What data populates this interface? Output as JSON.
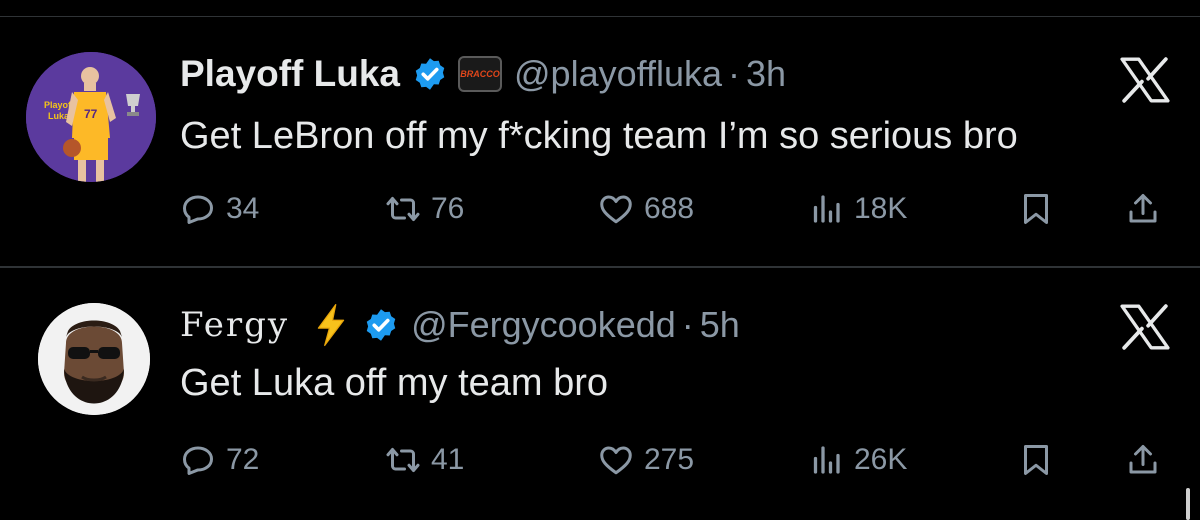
{
  "tweets": [
    {
      "name": "Playoff Luka",
      "badge_text": "BRACCO",
      "handle": "@playoffluka",
      "separator": "·",
      "time": "3h",
      "text": "Get LeBron off my f*cking team I’m so serious bro",
      "avatar_text": [
        "Playoff",
        "Luka"
      ],
      "jersey_number": "77",
      "replies": "34",
      "retweets": "76",
      "likes": "688",
      "views": "18K"
    },
    {
      "name": "Fergy",
      "emoji": "lightning-bolt",
      "handle": "@Fergycookedd",
      "separator": "·",
      "time": "5h",
      "text": "Get Luka off my team bro",
      "replies": "72",
      "retweets": "41",
      "likes": "275",
      "views": "26K"
    }
  ],
  "colors": {
    "background": "#000000",
    "text": "#e7e9ea",
    "muted": "#8b98a5",
    "verified": "#1d9bf0",
    "divider": "#2f3336"
  }
}
